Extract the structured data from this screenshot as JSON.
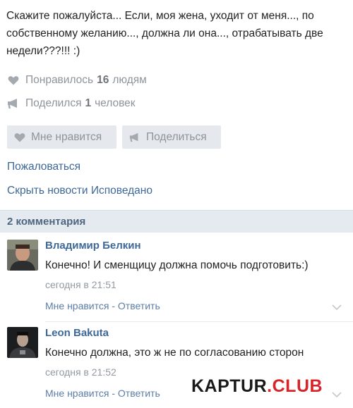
{
  "post": {
    "text": "Скажите пожалуйста... Если, моя жена, уходит от меня..., по собственному желанию..., должна ли она..., отрабатывать две недели???!!! :)"
  },
  "stats": {
    "likes_prefix": "Понравилось",
    "likes_count": "16",
    "likes_suffix": "людям",
    "shares_prefix": "Поделился",
    "shares_count": "1",
    "shares_suffix": "человек"
  },
  "actions": {
    "like_label": "Мне нравится",
    "share_label": "Поделиться"
  },
  "links": {
    "report": "Пожаловаться",
    "hide_news": "Скрыть новости Исповедано"
  },
  "comments_header": "2 комментария",
  "comments": [
    {
      "author": "Владимир Белкин",
      "text": "Конечно! И сменщицу должна помочь подготовить:)",
      "time": "сегодня в 21:51",
      "actions": "Мне нравится - Ответить"
    },
    {
      "author": "Leon Bakuta",
      "text": "Конечно должна, это ж не по согласованию сторон",
      "time": "сегодня в 21:52",
      "actions": "Мне нравится - Ответить"
    }
  ],
  "watermark": {
    "part1": "KAPTUR",
    "part2": ".CLUB"
  },
  "icons": {
    "heart": "heart-icon",
    "megaphone": "megaphone-icon",
    "chevron": "chevron-down-icon"
  },
  "colors": {
    "link": "#3d6898",
    "muted": "#8e949a",
    "button_bg": "#e5e8ec",
    "header_bg": "#e5eaf0",
    "watermark_red": "#d9232b"
  }
}
